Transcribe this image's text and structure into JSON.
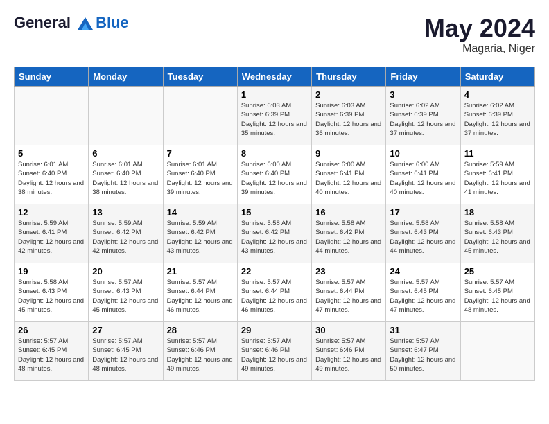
{
  "header": {
    "logo_line1": "General",
    "logo_line2": "Blue",
    "month_year": "May 2024",
    "location": "Magaria, Niger"
  },
  "weekdays": [
    "Sunday",
    "Monday",
    "Tuesday",
    "Wednesday",
    "Thursday",
    "Friday",
    "Saturday"
  ],
  "weeks": [
    [
      {
        "day": "",
        "sunrise": "",
        "sunset": "",
        "daylight": ""
      },
      {
        "day": "",
        "sunrise": "",
        "sunset": "",
        "daylight": ""
      },
      {
        "day": "",
        "sunrise": "",
        "sunset": "",
        "daylight": ""
      },
      {
        "day": "1",
        "sunrise": "Sunrise: 6:03 AM",
        "sunset": "Sunset: 6:39 PM",
        "daylight": "Daylight: 12 hours and 35 minutes."
      },
      {
        "day": "2",
        "sunrise": "Sunrise: 6:03 AM",
        "sunset": "Sunset: 6:39 PM",
        "daylight": "Daylight: 12 hours and 36 minutes."
      },
      {
        "day": "3",
        "sunrise": "Sunrise: 6:02 AM",
        "sunset": "Sunset: 6:39 PM",
        "daylight": "Daylight: 12 hours and 37 minutes."
      },
      {
        "day": "4",
        "sunrise": "Sunrise: 6:02 AM",
        "sunset": "Sunset: 6:39 PM",
        "daylight": "Daylight: 12 hours and 37 minutes."
      }
    ],
    [
      {
        "day": "5",
        "sunrise": "Sunrise: 6:01 AM",
        "sunset": "Sunset: 6:40 PM",
        "daylight": "Daylight: 12 hours and 38 minutes."
      },
      {
        "day": "6",
        "sunrise": "Sunrise: 6:01 AM",
        "sunset": "Sunset: 6:40 PM",
        "daylight": "Daylight: 12 hours and 38 minutes."
      },
      {
        "day": "7",
        "sunrise": "Sunrise: 6:01 AM",
        "sunset": "Sunset: 6:40 PM",
        "daylight": "Daylight: 12 hours and 39 minutes."
      },
      {
        "day": "8",
        "sunrise": "Sunrise: 6:00 AM",
        "sunset": "Sunset: 6:40 PM",
        "daylight": "Daylight: 12 hours and 39 minutes."
      },
      {
        "day": "9",
        "sunrise": "Sunrise: 6:00 AM",
        "sunset": "Sunset: 6:41 PM",
        "daylight": "Daylight: 12 hours and 40 minutes."
      },
      {
        "day": "10",
        "sunrise": "Sunrise: 6:00 AM",
        "sunset": "Sunset: 6:41 PM",
        "daylight": "Daylight: 12 hours and 40 minutes."
      },
      {
        "day": "11",
        "sunrise": "Sunrise: 5:59 AM",
        "sunset": "Sunset: 6:41 PM",
        "daylight": "Daylight: 12 hours and 41 minutes."
      }
    ],
    [
      {
        "day": "12",
        "sunrise": "Sunrise: 5:59 AM",
        "sunset": "Sunset: 6:41 PM",
        "daylight": "Daylight: 12 hours and 42 minutes."
      },
      {
        "day": "13",
        "sunrise": "Sunrise: 5:59 AM",
        "sunset": "Sunset: 6:42 PM",
        "daylight": "Daylight: 12 hours and 42 minutes."
      },
      {
        "day": "14",
        "sunrise": "Sunrise: 5:59 AM",
        "sunset": "Sunset: 6:42 PM",
        "daylight": "Daylight: 12 hours and 43 minutes."
      },
      {
        "day": "15",
        "sunrise": "Sunrise: 5:58 AM",
        "sunset": "Sunset: 6:42 PM",
        "daylight": "Daylight: 12 hours and 43 minutes."
      },
      {
        "day": "16",
        "sunrise": "Sunrise: 5:58 AM",
        "sunset": "Sunset: 6:42 PM",
        "daylight": "Daylight: 12 hours and 44 minutes."
      },
      {
        "day": "17",
        "sunrise": "Sunrise: 5:58 AM",
        "sunset": "Sunset: 6:43 PM",
        "daylight": "Daylight: 12 hours and 44 minutes."
      },
      {
        "day": "18",
        "sunrise": "Sunrise: 5:58 AM",
        "sunset": "Sunset: 6:43 PM",
        "daylight": "Daylight: 12 hours and 45 minutes."
      }
    ],
    [
      {
        "day": "19",
        "sunrise": "Sunrise: 5:58 AM",
        "sunset": "Sunset: 6:43 PM",
        "daylight": "Daylight: 12 hours and 45 minutes."
      },
      {
        "day": "20",
        "sunrise": "Sunrise: 5:57 AM",
        "sunset": "Sunset: 6:43 PM",
        "daylight": "Daylight: 12 hours and 45 minutes."
      },
      {
        "day": "21",
        "sunrise": "Sunrise: 5:57 AM",
        "sunset": "Sunset: 6:44 PM",
        "daylight": "Daylight: 12 hours and 46 minutes."
      },
      {
        "day": "22",
        "sunrise": "Sunrise: 5:57 AM",
        "sunset": "Sunset: 6:44 PM",
        "daylight": "Daylight: 12 hours and 46 minutes."
      },
      {
        "day": "23",
        "sunrise": "Sunrise: 5:57 AM",
        "sunset": "Sunset: 6:44 PM",
        "daylight": "Daylight: 12 hours and 47 minutes."
      },
      {
        "day": "24",
        "sunrise": "Sunrise: 5:57 AM",
        "sunset": "Sunset: 6:45 PM",
        "daylight": "Daylight: 12 hours and 47 minutes."
      },
      {
        "day": "25",
        "sunrise": "Sunrise: 5:57 AM",
        "sunset": "Sunset: 6:45 PM",
        "daylight": "Daylight: 12 hours and 48 minutes."
      }
    ],
    [
      {
        "day": "26",
        "sunrise": "Sunrise: 5:57 AM",
        "sunset": "Sunset: 6:45 PM",
        "daylight": "Daylight: 12 hours and 48 minutes."
      },
      {
        "day": "27",
        "sunrise": "Sunrise: 5:57 AM",
        "sunset": "Sunset: 6:45 PM",
        "daylight": "Daylight: 12 hours and 48 minutes."
      },
      {
        "day": "28",
        "sunrise": "Sunrise: 5:57 AM",
        "sunset": "Sunset: 6:46 PM",
        "daylight": "Daylight: 12 hours and 49 minutes."
      },
      {
        "day": "29",
        "sunrise": "Sunrise: 5:57 AM",
        "sunset": "Sunset: 6:46 PM",
        "daylight": "Daylight: 12 hours and 49 minutes."
      },
      {
        "day": "30",
        "sunrise": "Sunrise: 5:57 AM",
        "sunset": "Sunset: 6:46 PM",
        "daylight": "Daylight: 12 hours and 49 minutes."
      },
      {
        "day": "31",
        "sunrise": "Sunrise: 5:57 AM",
        "sunset": "Sunset: 6:47 PM",
        "daylight": "Daylight: 12 hours and 50 minutes."
      },
      {
        "day": "",
        "sunrise": "",
        "sunset": "",
        "daylight": ""
      }
    ]
  ]
}
